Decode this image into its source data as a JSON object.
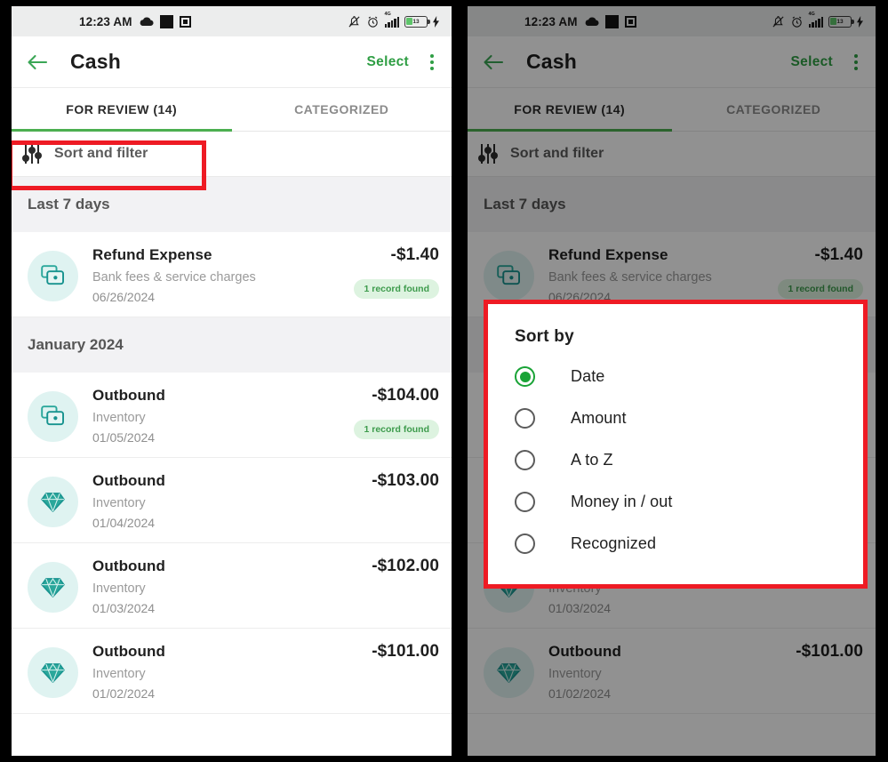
{
  "status_bar": {
    "time": "12:23 AM",
    "left_icons": [
      "cloud-icon",
      "screenshot-icon",
      "download-icon"
    ],
    "right_icons": [
      "bell-off-icon",
      "alarm-icon",
      "signal-4g-icon",
      "battery-icon",
      "charging-bolt-icon"
    ],
    "network_label": "4G",
    "battery_percent": "13",
    "bg_color": "#eceded"
  },
  "app_bar": {
    "back_label": "back-arrow",
    "title": "Cash",
    "select_label": "Select",
    "overflow_label": "more-options",
    "accent_color": "#2f9e44"
  },
  "tabs": [
    {
      "label": "FOR REVIEW (14)",
      "active": true
    },
    {
      "label": "CATEGORIZED",
      "active": false
    }
  ],
  "sort_filter": {
    "label": "Sort and filter",
    "icon": "sliders-icon"
  },
  "sections": [
    {
      "header": "Last 7 days",
      "rows": [
        {
          "icon": "stacked-cards-icon",
          "name": "Refund Expense",
          "category": "Bank fees & service charges",
          "date": "06/26/2024",
          "amount": "-$1.40",
          "badge": "1 record found"
        }
      ]
    },
    {
      "header": "January 2024",
      "rows": [
        {
          "icon": "stacked-cards-icon",
          "name": "Outbound",
          "category": "Inventory",
          "date": "01/05/2024",
          "amount": "-$104.00",
          "badge": "1 record found"
        },
        {
          "icon": "diamond-icon",
          "name": "Outbound",
          "category": "Inventory",
          "date": "01/04/2024",
          "amount": "-$103.00",
          "badge": ""
        },
        {
          "icon": "diamond-icon",
          "name": "Outbound",
          "category": "Inventory",
          "date": "01/03/2024",
          "amount": "-$102.00",
          "badge": ""
        },
        {
          "icon": "diamond-icon",
          "name": "Outbound",
          "category": "Inventory",
          "date": "01/02/2024",
          "amount": "-$101.00",
          "badge": ""
        }
      ]
    }
  ],
  "sort_dialog": {
    "title": "Sort by",
    "options": [
      {
        "label": "Date",
        "selected": true
      },
      {
        "label": "Amount",
        "selected": false
      },
      {
        "label": "A to Z",
        "selected": false
      },
      {
        "label": "Money in / out",
        "selected": false
      },
      {
        "label": "Recognized",
        "selected": false
      }
    ],
    "selected_color": "#19a336"
  },
  "annotation": {
    "highlight_color": "#ee1b24",
    "highlights": [
      "sort-and-filter-button",
      "sort-by-dialog"
    ]
  }
}
